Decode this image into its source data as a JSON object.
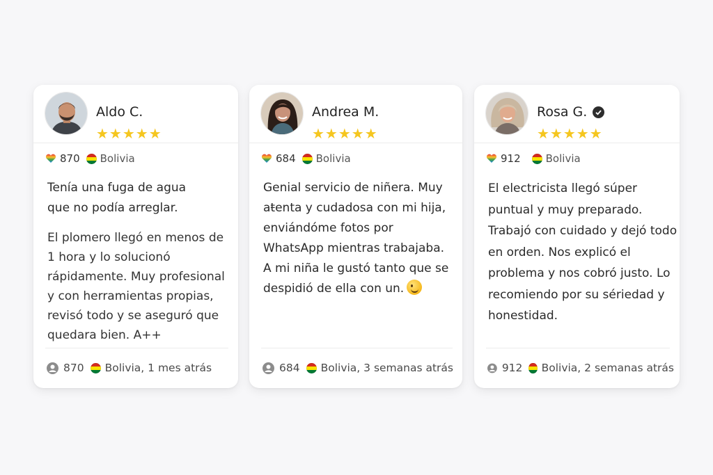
{
  "reviews": [
    {
      "name": "Aldo C.",
      "verified": false,
      "stars": "★★★★★",
      "rating": 5,
      "points": "870",
      "country": "Bolivia",
      "paragraphs": [
        "Tenía una fuga de agua que no podía arreglar.",
        "El plomero llegó en menos de 1 hora y lo solucionó rápidamente. Muy profesional y con herramientas propias, revisó todo y se aseguró que quedara bien. A++"
      ],
      "footer_points": "870",
      "footer_location": "Bolivia, 1 mes atrás"
    },
    {
      "name": "Andrea M.",
      "verified": false,
      "stars": "★★★★★",
      "rating": 5,
      "points": "684",
      "country": "Bolivia",
      "paragraphs": [
        "Genial servicio de niñera. Muy aŧenta y cudadosa con mi hija, enviándóme fotos por WhatsApp mientras trabajaba. A mi niña le gustó tanto que se despidió de ella con un."
      ],
      "footer_points": "684",
      "footer_location": "Bolivia, 3 semanas atrás"
    },
    {
      "name": "Rosa G.",
      "verified": true,
      "stars": "★★★★★",
      "rating": 5,
      "points": "912",
      "country": "Bolivia",
      "paragraphs": [
        "El electricista llegó súper puntual y muy preparado. Trabajó con cuidado y dejó todo en orden. Nos explicó el problema y nos cobró justo. Lo recomiendo por su sériedad y honestidad."
      ],
      "footer_points": "912",
      "footer_location": "Bolivia, 2 semanas atrás"
    }
  ],
  "colors": {
    "star": "#f5c61f",
    "card_bg": "#ffffff",
    "page_bg": "#f7f7f9"
  },
  "icons": {
    "heart": "rainbow-heart-icon",
    "flag": "bolivia-flag-icon",
    "user": "user-circle-icon",
    "verified": "verified-check-icon"
  }
}
